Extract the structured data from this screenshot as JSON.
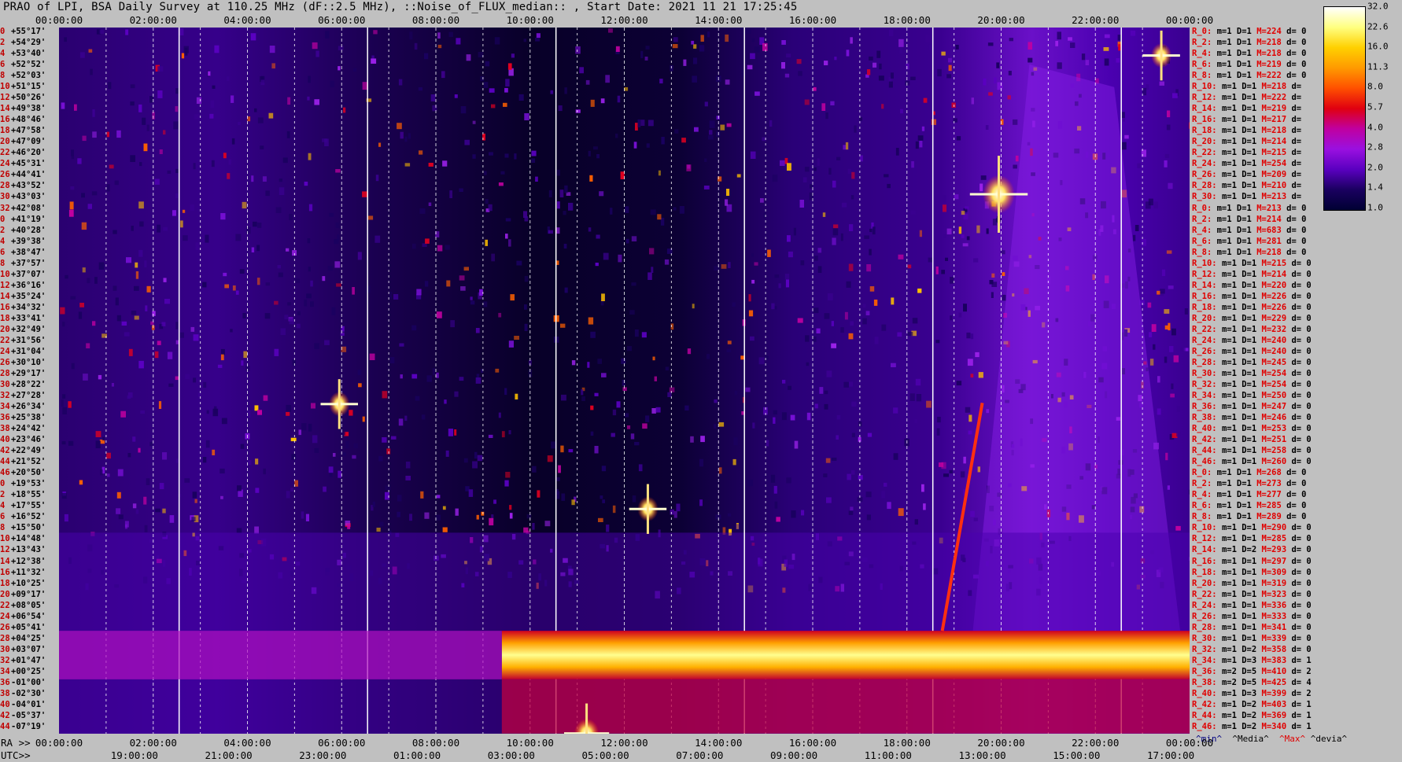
{
  "title": "PRAO of LPI, BSA Daily Survey at 110.25 MHz (dF::2.5 MHz), ::Noise_of_FLUX_median:: , Start Date: 2021 11 21 17:25:45",
  "axes": {
    "top_ticks": [
      "00:00:00",
      "02:00:00",
      "04:00:00",
      "06:00:00",
      "08:00:00",
      "10:00:00",
      "12:00:00",
      "14:00:00",
      "16:00:00",
      "18:00:00",
      "20:00:00",
      "22:00:00",
      "00:00:00"
    ],
    "ra_prefix": "RA >>",
    "ra_ticks": [
      "00:00:00",
      "02:00:00",
      "04:00:00",
      "06:00:00",
      "08:00:00",
      "10:00:00",
      "12:00:00",
      "14:00:00",
      "16:00:00",
      "18:00:00",
      "20:00:00",
      "22:00:00",
      "00:00:00"
    ],
    "utc_prefix": "UTC>>",
    "utc_ticks": [
      "19:00:00",
      "21:00:00",
      "23:00:00",
      "01:00:00",
      "03:00:00",
      "05:00:00",
      "07:00:00",
      "09:00:00",
      "11:00:00",
      "13:00:00",
      "15:00:00",
      "17:00:00"
    ]
  },
  "declinations": [
    [
      "0",
      "+55°17'"
    ],
    [
      "2",
      "+54°29'"
    ],
    [
      "4",
      "+53°40'"
    ],
    [
      "6",
      "+52°52'"
    ],
    [
      "8",
      "+52°03'"
    ],
    [
      "10",
      "+51°15'"
    ],
    [
      "12",
      "+50°26'"
    ],
    [
      "14",
      "+49°38'"
    ],
    [
      "16",
      "+48°46'"
    ],
    [
      "18",
      "+47°58'"
    ],
    [
      "20",
      "+47°09'"
    ],
    [
      "22",
      "+46°20'"
    ],
    [
      "24",
      "+45°31'"
    ],
    [
      "26",
      "+44°41'"
    ],
    [
      "28",
      "+43°52'"
    ],
    [
      "30",
      "+43°03'"
    ],
    [
      "32",
      "+42°08'"
    ],
    [
      "0",
      "+41°19'"
    ],
    [
      "2",
      "+40°28'"
    ],
    [
      "4",
      "+39°38'"
    ],
    [
      "6",
      "+38°47'"
    ],
    [
      "8",
      "+37°57'"
    ],
    [
      "10",
      "+37°07'"
    ],
    [
      "12",
      "+36°16'"
    ],
    [
      "14",
      "+35°24'"
    ],
    [
      "16",
      "+34°32'"
    ],
    [
      "18",
      "+33°41'"
    ],
    [
      "20",
      "+32°49'"
    ],
    [
      "22",
      "+31°56'"
    ],
    [
      "24",
      "+31°04'"
    ],
    [
      "26",
      "+30°10'"
    ],
    [
      "28",
      "+29°17'"
    ],
    [
      "30",
      "+28°22'"
    ],
    [
      "32",
      "+27°28'"
    ],
    [
      "34",
      "+26°34'"
    ],
    [
      "36",
      "+25°38'"
    ],
    [
      "38",
      "+24°42'"
    ],
    [
      "40",
      "+23°46'"
    ],
    [
      "42",
      "+22°49'"
    ],
    [
      "44",
      "+21°52'"
    ],
    [
      "46",
      "+20°50'"
    ],
    [
      "0",
      "+19°53'"
    ],
    [
      "2",
      "+18°55'"
    ],
    [
      "4",
      "+17°55'"
    ],
    [
      "6",
      "+16°52'"
    ],
    [
      "8",
      "+15°50'"
    ],
    [
      "10",
      "+14°48'"
    ],
    [
      "12",
      "+13°43'"
    ],
    [
      "14",
      "+12°38'"
    ],
    [
      "16",
      "+11°32'"
    ],
    [
      "18",
      "+10°25'"
    ],
    [
      "20",
      "+09°17'"
    ],
    [
      "22",
      "+08°05'"
    ],
    [
      "24",
      "+06°54'"
    ],
    [
      "26",
      "+05°41'"
    ],
    [
      "28",
      "+04°25'"
    ],
    [
      "30",
      "+03°07'"
    ],
    [
      "32",
      "+01°47'"
    ],
    [
      "34",
      "+00°25'"
    ],
    [
      "36",
      "-01°00'"
    ],
    [
      "38",
      "-02°30'"
    ],
    [
      "40",
      "-04°01'"
    ],
    [
      "42",
      "-05°37'"
    ],
    [
      "44",
      "-07°19'"
    ]
  ],
  "stats": [
    [
      "R_0:",
      "m=1",
      "D=1",
      "M=224",
      "d= 0"
    ],
    [
      "R_2:",
      "m=1",
      "D=1",
      "M=218",
      "d= 0"
    ],
    [
      "R_4:",
      "m=1",
      "D=1",
      "M=218",
      "d= 0"
    ],
    [
      "R_6:",
      "m=1",
      "D=1",
      "M=219",
      "d= 0"
    ],
    [
      "R_8:",
      "m=1",
      "D=1",
      "M=222",
      "d= 0"
    ],
    [
      "R_10:",
      "m=1",
      "D=1",
      "M=218",
      "d="
    ],
    [
      "R_12:",
      "m=1",
      "D=1",
      "M=222",
      "d="
    ],
    [
      "R_14:",
      "m=1",
      "D=1",
      "M=219",
      "d="
    ],
    [
      "R_16:",
      "m=1",
      "D=1",
      "M=217",
      "d="
    ],
    [
      "R_18:",
      "m=1",
      "D=1",
      "M=218",
      "d="
    ],
    [
      "R_20:",
      "m=1",
      "D=1",
      "M=214",
      "d="
    ],
    [
      "R_22:",
      "m=1",
      "D=1",
      "M=215",
      "d="
    ],
    [
      "R_24:",
      "m=1",
      "D=1",
      "M=254",
      "d="
    ],
    [
      "R_26:",
      "m=1",
      "D=1",
      "M=209",
      "d="
    ],
    [
      "R_28:",
      "m=1",
      "D=1",
      "M=210",
      "d="
    ],
    [
      "R_30:",
      "m=1",
      "D=1",
      "M=213",
      "d="
    ],
    [
      "R_0:",
      "m=1",
      "D=1",
      "M=213",
      "d= 0"
    ],
    [
      "R_2:",
      "m=1",
      "D=1",
      "M=214",
      "d= 0"
    ],
    [
      "R_4:",
      "m=1",
      "D=1",
      "M=683",
      "d= 0"
    ],
    [
      "R_6:",
      "m=1",
      "D=1",
      "M=281",
      "d= 0"
    ],
    [
      "R_8:",
      "m=1",
      "D=1",
      "M=218",
      "d= 0"
    ],
    [
      "R_10:",
      "m=1",
      "D=1",
      "M=215",
      "d= 0"
    ],
    [
      "R_12:",
      "m=1",
      "D=1",
      "M=214",
      "d= 0"
    ],
    [
      "R_14:",
      "m=1",
      "D=1",
      "M=220",
      "d= 0"
    ],
    [
      "R_16:",
      "m=1",
      "D=1",
      "M=226",
      "d= 0"
    ],
    [
      "R_18:",
      "m=1",
      "D=1",
      "M=226",
      "d= 0"
    ],
    [
      "R_20:",
      "m=1",
      "D=1",
      "M=229",
      "d= 0"
    ],
    [
      "R_22:",
      "m=1",
      "D=1",
      "M=232",
      "d= 0"
    ],
    [
      "R_24:",
      "m=1",
      "D=1",
      "M=240",
      "d= 0"
    ],
    [
      "R_26:",
      "m=1",
      "D=1",
      "M=240",
      "d= 0"
    ],
    [
      "R_28:",
      "m=1",
      "D=1",
      "M=245",
      "d= 0"
    ],
    [
      "R_30:",
      "m=1",
      "D=1",
      "M=254",
      "d= 0"
    ],
    [
      "R_32:",
      "m=1",
      "D=1",
      "M=254",
      "d= 0"
    ],
    [
      "R_34:",
      "m=1",
      "D=1",
      "M=250",
      "d= 0"
    ],
    [
      "R_36:",
      "m=1",
      "D=1",
      "M=247",
      "d= 0"
    ],
    [
      "R_38:",
      "m=1",
      "D=1",
      "M=246",
      "d= 0"
    ],
    [
      "R_40:",
      "m=1",
      "D=1",
      "M=253",
      "d= 0"
    ],
    [
      "R_42:",
      "m=1",
      "D=1",
      "M=251",
      "d= 0"
    ],
    [
      "R_44:",
      "m=1",
      "D=1",
      "M=258",
      "d= 0"
    ],
    [
      "R_46:",
      "m=1",
      "D=1",
      "M=260",
      "d= 0"
    ],
    [
      "R_0:",
      "m=1",
      "D=1",
      "M=268",
      "d= 0"
    ],
    [
      "R_2:",
      "m=1",
      "D=1",
      "M=273",
      "d= 0"
    ],
    [
      "R_4:",
      "m=1",
      "D=1",
      "M=277",
      "d= 0"
    ],
    [
      "R_6:",
      "m=1",
      "D=1",
      "M=285",
      "d= 0"
    ],
    [
      "R_8:",
      "m=1",
      "D=1",
      "M=289",
      "d= 0"
    ],
    [
      "R_10:",
      "m=1",
      "D=1",
      "M=290",
      "d= 0"
    ],
    [
      "R_12:",
      "m=1",
      "D=1",
      "M=285",
      "d= 0"
    ],
    [
      "R_14:",
      "m=1",
      "D=2",
      "M=293",
      "d= 0"
    ],
    [
      "R_16:",
      "m=1",
      "D=1",
      "M=297",
      "d= 0"
    ],
    [
      "R_18:",
      "m=1",
      "D=1",
      "M=309",
      "d= 0"
    ],
    [
      "R_20:",
      "m=1",
      "D=1",
      "M=319",
      "d= 0"
    ],
    [
      "R_22:",
      "m=1",
      "D=1",
      "M=323",
      "d= 0"
    ],
    [
      "R_24:",
      "m=1",
      "D=1",
      "M=336",
      "d= 0"
    ],
    [
      "R_26:",
      "m=1",
      "D=1",
      "M=333",
      "d= 0"
    ],
    [
      "R_28:",
      "m=1",
      "D=1",
      "M=341",
      "d= 0"
    ],
    [
      "R_30:",
      "m=1",
      "D=1",
      "M=339",
      "d= 0"
    ],
    [
      "R_32:",
      "m=1",
      "D=2",
      "M=358",
      "d= 0"
    ],
    [
      "R_34:",
      "m=1",
      "D=3",
      "M=383",
      "d= 1"
    ],
    [
      "R_36:",
      "m=2",
      "D=5",
      "M=410",
      "d= 2"
    ],
    [
      "R_38:",
      "m=2",
      "D=5",
      "M=425",
      "d= 4"
    ],
    [
      "R_40:",
      "m=1",
      "D=3",
      "M=399",
      "d= 2"
    ],
    [
      "R_42:",
      "m=1",
      "D=2",
      "M=403",
      "d= 1"
    ],
    [
      "R_44:",
      "m=1",
      "D=2",
      "M=369",
      "d= 1"
    ],
    [
      "R_46:",
      "m=1",
      "D=2",
      "M=340",
      "d= 1"
    ]
  ],
  "stats_footer": {
    "min": "^min^",
    "median": "^Media^",
    "max": "^Max^",
    "dev": "^devia^"
  },
  "colorbar": {
    "labels": [
      "32.0",
      "22.6",
      "16.0",
      "11.3",
      "8.0",
      "5.7",
      "4.0",
      "2.8",
      "2.0",
      "1.4",
      "1.0"
    ],
    "colors": [
      "#000033",
      "#1a0060",
      "#5a00c0",
      "#9a10e0",
      "#c000a0",
      "#e00010",
      "#ff5000",
      "#ff9a00",
      "#ffd000",
      "#ffff80",
      "#ffffff"
    ]
  },
  "chart_data": {
    "type": "heatmap",
    "title": "PRAO of LPI, BSA Daily Survey at 110.25 MHz (dF::2.5 MHz), ::Noise_of_FLUX_median:: , Start Date: 2021 11 21 17:25:45",
    "x": {
      "label_prefix_ra": "RA >>",
      "label_prefix_utc": "UTC>>",
      "range_hours": [
        0,
        24
      ]
    },
    "y": {
      "label": "",
      "range_deg": [
        55.28,
        -7.32
      ]
    },
    "color_scale": {
      "type": "log2",
      "min": 1.0,
      "max": 32.0
    },
    "features": [
      {
        "name": "bright band",
        "ra_hours_start": 9.4,
        "ra_hours_end": 24.0,
        "dec_deg": [
          -2.5,
          1.8
        ],
        "level": 20
      },
      {
        "name": "source",
        "ra_hours": 19.95,
        "dec_deg": 40.5,
        "level": 32
      },
      {
        "name": "source",
        "ra_hours": 5.95,
        "dec_deg": 21.9,
        "level": 16
      },
      {
        "name": "source",
        "ra_hours": 12.5,
        "dec_deg": 12.6,
        "level": 16
      },
      {
        "name": "source",
        "ra_hours": 23.4,
        "dec_deg": 52.8,
        "level": 16
      },
      {
        "name": "source",
        "ra_hours": 11.2,
        "dec_deg": -7.3,
        "level": 22
      }
    ]
  }
}
